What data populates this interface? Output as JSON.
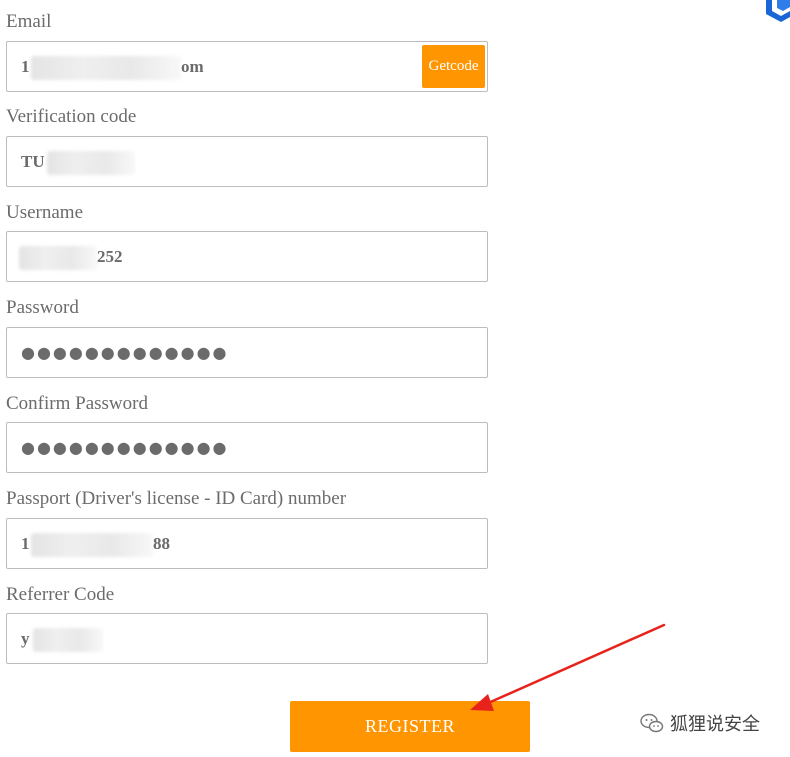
{
  "form": {
    "email": {
      "label": "Email",
      "value_start": "1",
      "value_end": "om",
      "getcode_label": "Getcode"
    },
    "verification": {
      "label": "Verification code",
      "value_start": "TU"
    },
    "username": {
      "label": "Username",
      "value_end": "252"
    },
    "password": {
      "label": "Password",
      "dots": "●●●●●●●●●●●●●"
    },
    "confirm_password": {
      "label": "Confirm Password",
      "dots": "●●●●●●●●●●●●●"
    },
    "passport": {
      "label": "Passport (Driver's license - ID Card) number",
      "value_start": "1",
      "value_end": "88"
    },
    "referrer": {
      "label": "Referrer Code",
      "value_start": "y"
    },
    "register_label": "REGISTER"
  },
  "watermark": {
    "text": "狐狸说安全"
  },
  "colors": {
    "accent": "#ff9500",
    "annotation_arrow": "#e8231c",
    "logo": "#1a66d6"
  }
}
